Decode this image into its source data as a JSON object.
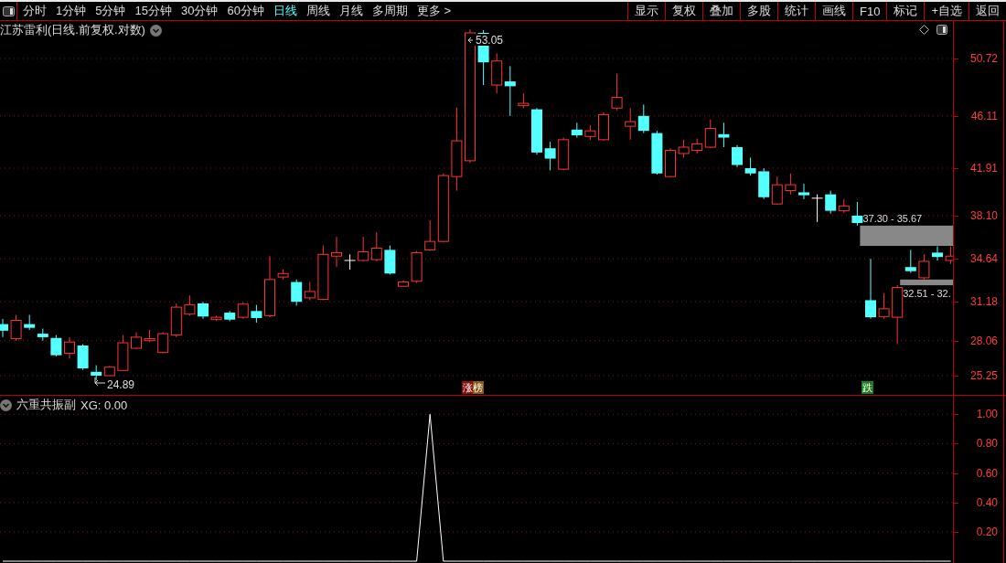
{
  "toolbar": {
    "periods": [
      {
        "label": "分时",
        "selected": false
      },
      {
        "label": "1分钟",
        "selected": false
      },
      {
        "label": "5分钟",
        "selected": false
      },
      {
        "label": "15分钟",
        "selected": false
      },
      {
        "label": "30分钟",
        "selected": false
      },
      {
        "label": "60分钟",
        "selected": false
      },
      {
        "label": "日线",
        "selected": true
      },
      {
        "label": "周线",
        "selected": false
      },
      {
        "label": "月线",
        "selected": false
      },
      {
        "label": "多周期",
        "selected": false
      },
      {
        "label": "更多 >",
        "selected": false
      }
    ],
    "buttons": [
      "显示",
      "复权",
      "叠加",
      "多股",
      "统计",
      "画线",
      "F10",
      "标记",
      "+自选",
      "返回"
    ]
  },
  "main_chart": {
    "title": "江苏雷利(日线.前复权.对数)",
    "high_label": "53.05",
    "low_label": "24.89",
    "badges": [
      {
        "text": "涨榜",
        "kind": "up"
      },
      {
        "text": "跌",
        "kind": "down"
      }
    ],
    "gaps": [
      {
        "label": "37.30 - 35.67"
      },
      {
        "label": "32.51 - 32."
      }
    ],
    "chart_data": {
      "type": "candlestick",
      "ylim": [
        23.71,
        53.73
      ],
      "grid": true,
      "yticks": [
        {
          "value": 50.72,
          "label": "50.72"
        },
        {
          "value": 46.11,
          "label": "46.11"
        },
        {
          "value": 41.91,
          "label": "41.91"
        },
        {
          "value": 38.1,
          "label": "38.10"
        },
        {
          "value": 34.64,
          "label": "34.64"
        },
        {
          "value": 31.18,
          "label": "31.18"
        },
        {
          "value": 28.06,
          "label": "28.06"
        },
        {
          "value": 25.25,
          "label": "25.25"
        }
      ],
      "ohlc": [
        [
          29.39,
          29.8,
          28.35,
          28.86
        ],
        [
          28.23,
          30.13,
          28.06,
          29.69
        ],
        [
          29.39,
          30.13,
          28.92,
          29.09
        ],
        [
          28.62,
          29.03,
          28.06,
          28.34
        ],
        [
          28.28,
          28.51,
          26.79,
          26.89
        ],
        [
          27.05,
          28.34,
          26.63,
          27.95
        ],
        [
          27.67,
          27.78,
          25.72,
          25.83
        ],
        [
          25.56,
          26.09,
          24.89,
          25.25
        ],
        [
          25.25,
          26.03,
          25.2,
          25.93
        ],
        [
          25.67,
          28.51,
          25.62,
          27.89
        ],
        [
          27.45,
          28.73,
          27.39,
          28.34
        ],
        [
          28.06,
          28.92,
          27.95,
          28.23
        ],
        [
          27.11,
          28.73,
          27.05,
          28.62
        ],
        [
          28.51,
          31.05,
          28.34,
          30.75
        ],
        [
          30.19,
          31.69,
          30.07,
          30.93
        ],
        [
          31.05,
          31.18,
          29.82,
          30.0
        ],
        [
          29.75,
          30.07,
          29.63,
          29.94
        ],
        [
          30.31,
          30.44,
          29.63,
          29.75
        ],
        [
          29.94,
          31.12,
          29.82,
          30.99
        ],
        [
          30.44,
          30.93,
          29.51,
          29.88
        ],
        [
          30.07,
          34.85,
          29.94,
          32.97
        ],
        [
          33.17,
          33.77,
          32.97,
          33.45
        ],
        [
          32.77,
          32.97,
          30.87,
          31.18
        ],
        [
          31.5,
          32.77,
          31.31,
          32.01
        ],
        [
          31.37,
          35.7,
          31.31,
          34.99
        ],
        [
          34.85,
          36.4,
          33.97,
          35.13
        ],
        [
          34.5,
          34.99,
          33.77,
          34.5
        ],
        [
          34.5,
          36.4,
          34.43,
          35.2
        ],
        [
          34.57,
          36.77,
          34.43,
          35.49
        ],
        [
          35.35,
          35.7,
          33.38,
          33.45
        ],
        [
          32.43,
          32.9,
          32.37,
          32.77
        ],
        [
          32.83,
          35.27,
          32.7,
          35.13
        ],
        [
          35.35,
          37.73,
          35.27,
          36.03
        ],
        [
          36.03,
          41.49,
          35.96,
          41.32
        ],
        [
          41.24,
          46.78,
          40.11,
          44.11
        ],
        [
          42.51,
          53.05,
          42.34,
          52.78
        ],
        [
          52.78,
          53.0,
          48.59,
          50.41
        ],
        [
          48.59,
          51.13,
          47.91,
          50.52
        ],
        [
          48.88,
          50.11,
          46.11,
          48.49
        ],
        [
          46.93,
          47.91,
          46.74,
          47.12
        ],
        [
          46.64,
          46.74,
          43.0,
          43.17
        ],
        [
          43.51,
          44.03,
          41.74,
          42.68
        ],
        [
          41.83,
          44.37,
          41.74,
          44.2
        ],
        [
          45.01,
          45.56,
          44.37,
          44.55
        ],
        [
          44.46,
          45.37,
          44.2,
          44.91
        ],
        [
          44.2,
          46.4,
          44.11,
          46.2
        ],
        [
          46.74,
          49.5,
          46.55,
          47.6
        ],
        [
          45.28,
          46.74,
          44.2,
          45.65
        ],
        [
          46.11,
          47.02,
          44.73,
          44.91
        ],
        [
          44.73,
          44.91,
          41.4,
          41.49
        ],
        [
          41.24,
          43.51,
          41.16,
          43.34
        ],
        [
          43.09,
          44.2,
          42.76,
          43.6
        ],
        [
          43.34,
          44.29,
          43.09,
          43.86
        ],
        [
          43.6,
          45.83,
          43.51,
          45.1
        ],
        [
          44.64,
          45.56,
          43.6,
          44.37
        ],
        [
          43.6,
          43.77,
          42.0,
          42.17
        ],
        [
          41.91,
          42.76,
          41.32,
          41.49
        ],
        [
          41.66,
          41.91,
          39.43,
          39.58
        ],
        [
          39.04,
          41.24,
          38.96,
          40.58
        ],
        [
          40.11,
          41.49,
          39.81,
          40.58
        ],
        [
          39.97,
          40.66,
          39.43,
          39.74
        ],
        [
          39.5,
          39.81,
          37.59,
          39.5
        ],
        [
          39.81,
          40.11,
          38.26,
          38.49
        ],
        [
          38.49,
          39.43,
          38.33,
          38.88
        ],
        [
          38.1,
          39.2,
          37.3,
          37.51
        ],
        [
          31.31,
          34.64,
          29.82,
          29.94
        ],
        [
          30.0,
          31.88,
          29.82,
          30.62
        ],
        [
          29.94,
          32.51,
          27.78,
          32.33
        ],
        [
          33.97,
          35.35,
          33.51,
          33.64
        ],
        [
          33.11,
          34.99,
          32.97,
          34.43
        ],
        [
          35.13,
          35.63,
          34.5,
          34.78
        ],
        [
          34.5,
          35.63,
          34.22,
          34.85
        ]
      ]
    }
  },
  "indicator": {
    "title": "六重共振副",
    "reading": "XG: 0.00",
    "chart_data": {
      "type": "line",
      "ylim": [
        0,
        1.12
      ],
      "grid": true,
      "yticks": [
        {
          "value": 1,
          "label": "1.00"
        },
        {
          "value": 0.8,
          "label": "0.80"
        },
        {
          "value": 0.6,
          "label": "0.60"
        },
        {
          "value": 0.4,
          "label": "0.40"
        },
        {
          "value": 0.2,
          "label": "0.20"
        }
      ],
      "series": [
        {
          "color": "#ffffff",
          "values": [
            0,
            0,
            0,
            0,
            0,
            0,
            0,
            0,
            0,
            0,
            0,
            0,
            0,
            0,
            0,
            0,
            0,
            0,
            0,
            0,
            0,
            0,
            0,
            0,
            0,
            0,
            0,
            0,
            0,
            0,
            0,
            0,
            1,
            0,
            0,
            0,
            0,
            0,
            0,
            0,
            0,
            0,
            0,
            0,
            0,
            0,
            0,
            0,
            0,
            0,
            0,
            0,
            0,
            0,
            0,
            0,
            0,
            0,
            0,
            0,
            0,
            0,
            0,
            0,
            0,
            0,
            0,
            0,
            0,
            0,
            0,
            0
          ]
        }
      ]
    }
  }
}
